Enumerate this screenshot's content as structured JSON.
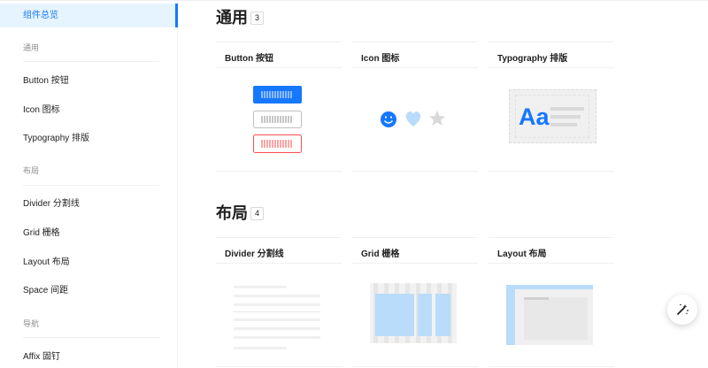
{
  "sidebar": {
    "active_item": "组件总览",
    "groups": [
      {
        "label": "通用",
        "items": [
          {
            "label": "Button 按钮"
          },
          {
            "label": "Icon 图标"
          },
          {
            "label": "Typography 排版"
          }
        ]
      },
      {
        "label": "布局",
        "items": [
          {
            "label": "Divider 分割线"
          },
          {
            "label": "Grid 栅格"
          },
          {
            "label": "Layout 布局"
          },
          {
            "label": "Space 间距"
          }
        ]
      },
      {
        "label": "导航",
        "items": [
          {
            "label": "Affix 固钉"
          }
        ]
      }
    ]
  },
  "sections": [
    {
      "title": "通用",
      "count": "3",
      "cards": [
        {
          "title": "Button 按钮"
        },
        {
          "title": "Icon 图标"
        },
        {
          "title": "Typography 排版"
        }
      ]
    },
    {
      "title": "布局",
      "count": "4",
      "cards": [
        {
          "title": "Divider 分割线"
        },
        {
          "title": "Grid 栅格"
        },
        {
          "title": "Layout 布局"
        }
      ]
    }
  ],
  "previews": {
    "typography_glyph": "Aa"
  },
  "colors": {
    "primary": "#1677ff",
    "primary_bg": "#e6f4ff",
    "danger": "#ff4d4f",
    "light_blue": "#b9dcfa",
    "border": "#f0f0f0"
  },
  "icons": {
    "fab": "magic-wand-icon",
    "icon_preview": [
      "smile-icon",
      "heart-icon",
      "star-icon"
    ]
  }
}
